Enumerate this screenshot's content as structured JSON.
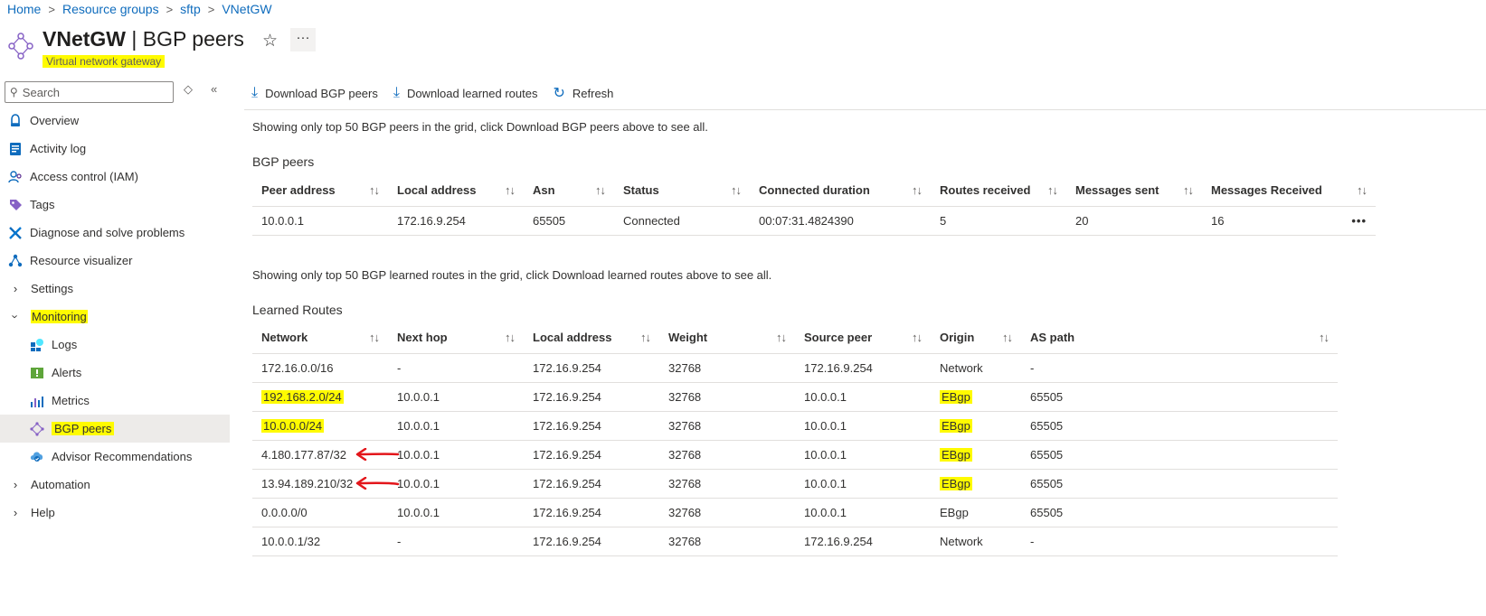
{
  "breadcrumb": {
    "items": [
      "Home",
      "Resource groups",
      "sftp",
      "VNetGW"
    ],
    "separator": ">"
  },
  "header": {
    "resource_name": "VNetGW",
    "separator": "|",
    "page_name": "BGP peers",
    "subtitle": "Virtual network gateway",
    "star_icon": "☆",
    "more_icon": "···"
  },
  "sidebar": {
    "search_placeholder": "Search",
    "collapse_icon": "«",
    "sort_icon": "◇",
    "items": [
      {
        "label": "Overview"
      },
      {
        "label": "Activity log"
      },
      {
        "label": "Access control (IAM)"
      },
      {
        "label": "Tags"
      },
      {
        "label": "Diagnose and solve problems"
      },
      {
        "label": "Resource visualizer"
      },
      {
        "label": "Settings"
      },
      {
        "label": "Monitoring"
      },
      {
        "label": "Logs"
      },
      {
        "label": "Alerts"
      },
      {
        "label": "Metrics"
      },
      {
        "label": "BGP peers"
      },
      {
        "label": "Advisor Recommendations"
      },
      {
        "label": "Automation"
      },
      {
        "label": "Help"
      }
    ]
  },
  "toolbar": {
    "download_peers": "Download BGP peers",
    "download_routes": "Download learned routes",
    "refresh": "Refresh"
  },
  "peers": {
    "note": "Showing only top 50 BGP peers in the grid, click Download BGP peers above to see all.",
    "title": "BGP peers",
    "columns": [
      "Peer address",
      "Local address",
      "Asn",
      "Status",
      "Connected duration",
      "Routes received",
      "Messages sent",
      "Messages Received"
    ],
    "rows": [
      [
        "10.0.0.1",
        "172.16.9.254",
        "65505",
        "Connected",
        "00:07:31.4824390",
        "5",
        "20",
        "16"
      ]
    ],
    "row_more": "•••"
  },
  "routes": {
    "note": "Showing only top 50 BGP learned routes in the grid, click Download learned routes above to see all.",
    "title": "Learned Routes",
    "columns": [
      "Network",
      "Next hop",
      "Local address",
      "Weight",
      "Source peer",
      "Origin",
      "AS path"
    ],
    "rows": [
      [
        "172.16.0.0/16",
        "-",
        "172.16.9.254",
        "32768",
        "172.16.9.254",
        "Network",
        "-"
      ],
      [
        "192.168.2.0/24",
        "10.0.0.1",
        "172.16.9.254",
        "32768",
        "10.0.0.1",
        "EBgp",
        "65505"
      ],
      [
        "10.0.0.0/24",
        "10.0.0.1",
        "172.16.9.254",
        "32768",
        "10.0.0.1",
        "EBgp",
        "65505"
      ],
      [
        "4.180.177.87/32",
        "10.0.0.1",
        "172.16.9.254",
        "32768",
        "10.0.0.1",
        "EBgp",
        "65505"
      ],
      [
        "13.94.189.210/32",
        "10.0.0.1",
        "172.16.9.254",
        "32768",
        "10.0.0.1",
        "EBgp",
        "65505"
      ],
      [
        "0.0.0.0/0",
        "10.0.0.1",
        "172.16.9.254",
        "32768",
        "10.0.0.1",
        "EBgp",
        "65505"
      ],
      [
        "10.0.0.1/32",
        "-",
        "172.16.9.254",
        "32768",
        "172.16.9.254",
        "Network",
        "-"
      ]
    ]
  },
  "sort_icon": "↑↓",
  "colors": {
    "link": "#0f6cbd",
    "highlight": "#fffb00",
    "annotation_arrow": "#e3161b",
    "selected_bg": "#edebe9"
  }
}
